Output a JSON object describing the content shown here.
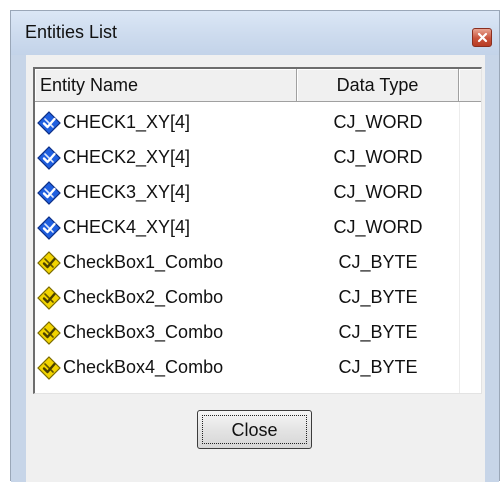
{
  "window": {
    "title": "Entities List"
  },
  "table": {
    "columns": [
      "Entity Name",
      "Data Type"
    ],
    "rows": [
      {
        "name": "CHECK1_XY[4]",
        "type": "CJ_WORD",
        "icon": "word-entity-icon",
        "icon_color": "#1f5fe0"
      },
      {
        "name": "CHECK2_XY[4]",
        "type": "CJ_WORD",
        "icon": "word-entity-icon",
        "icon_color": "#1f5fe0"
      },
      {
        "name": "CHECK3_XY[4]",
        "type": "CJ_WORD",
        "icon": "word-entity-icon",
        "icon_color": "#1f5fe0"
      },
      {
        "name": "CHECK4_XY[4]",
        "type": "CJ_WORD",
        "icon": "word-entity-icon",
        "icon_color": "#1f5fe0"
      },
      {
        "name": "CheckBox1_Combo",
        "type": "CJ_BYTE",
        "icon": "byte-entity-icon",
        "icon_color": "#f2d400"
      },
      {
        "name": "CheckBox2_Combo",
        "type": "CJ_BYTE",
        "icon": "byte-entity-icon",
        "icon_color": "#f2d400"
      },
      {
        "name": "CheckBox3_Combo",
        "type": "CJ_BYTE",
        "icon": "byte-entity-icon",
        "icon_color": "#f2d400"
      },
      {
        "name": "CheckBox4_Combo",
        "type": "CJ_BYTE",
        "icon": "byte-entity-icon",
        "icon_color": "#f2d400"
      }
    ]
  },
  "buttons": {
    "close_label": "Close"
  }
}
